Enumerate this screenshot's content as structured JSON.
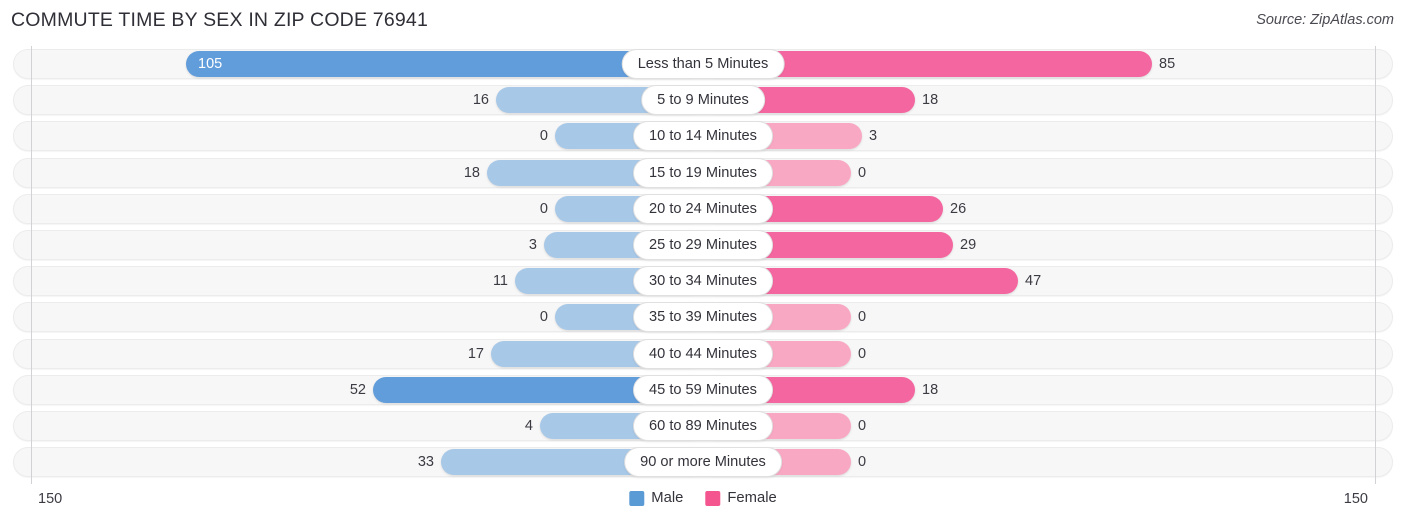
{
  "header": {
    "title": "COMMUTE TIME BY SEX IN ZIP CODE 76941",
    "source": "Source: ZipAtlas.com"
  },
  "axis": {
    "left_max": "150",
    "right_max": "150"
  },
  "legend": {
    "items": [
      {
        "label": "Male",
        "color": "#5b9bd5"
      },
      {
        "label": "Female",
        "color": "#f4558e"
      }
    ]
  },
  "colors": {
    "male_strong": "#629ddb",
    "male_light": "#a8c8e8",
    "female_strong": "#f4669f",
    "female_light": "#f9a8c4",
    "track": "#f7f7f7",
    "axis": "#d2d2d6"
  },
  "chart_data": {
    "type": "bar",
    "subtype": "diverging-horizontal",
    "title": "COMMUTE TIME BY SEX IN ZIP CODE 76941",
    "xlabel": "",
    "ylabel": "",
    "xlim": [
      150,
      150
    ],
    "grid": false,
    "legend_position": "bottom-center",
    "categories": [
      "Less than 5 Minutes",
      "5 to 9 Minutes",
      "10 to 14 Minutes",
      "15 to 19 Minutes",
      "20 to 24 Minutes",
      "25 to 29 Minutes",
      "30 to 34 Minutes",
      "35 to 39 Minutes",
      "40 to 44 Minutes",
      "45 to 59 Minutes",
      "60 to 89 Minutes",
      "90 or more Minutes"
    ],
    "series": [
      {
        "name": "Male",
        "direction": "left",
        "color": "#5b9bd5",
        "values": [
          105,
          16,
          0,
          18,
          0,
          3,
          11,
          0,
          17,
          52,
          4,
          33
        ]
      },
      {
        "name": "Female",
        "direction": "right",
        "color": "#f4558e",
        "values": [
          85,
          18,
          3,
          0,
          26,
          29,
          47,
          0,
          0,
          18,
          0,
          0
        ]
      }
    ]
  },
  "rows": [
    {
      "label": "Less than 5 Minutes",
      "male": "105",
      "female": "85",
      "male_w": 517,
      "female_w": 449,
      "male_strong": true,
      "female_strong": true,
      "male_inside": true
    },
    {
      "label": "5 to 9 Minutes",
      "male": "16",
      "female": "18",
      "male_w": 207,
      "female_w": 212,
      "male_strong": false,
      "female_strong": true,
      "male_inside": false
    },
    {
      "label": "10 to 14 Minutes",
      "male": "0",
      "female": "3",
      "male_w": 148,
      "female_w": 159,
      "male_strong": false,
      "female_strong": false,
      "male_inside": false
    },
    {
      "label": "15 to 19 Minutes",
      "male": "18",
      "female": "0",
      "male_w": 216,
      "female_w": 148,
      "male_strong": false,
      "female_strong": false,
      "male_inside": false
    },
    {
      "label": "20 to 24 Minutes",
      "male": "0",
      "female": "26",
      "male_w": 148,
      "female_w": 240,
      "male_strong": false,
      "female_strong": true,
      "male_inside": false
    },
    {
      "label": "25 to 29 Minutes",
      "male": "3",
      "female": "29",
      "male_w": 159,
      "female_w": 250,
      "male_strong": false,
      "female_strong": true,
      "male_inside": false
    },
    {
      "label": "30 to 34 Minutes",
      "male": "11",
      "female": "47",
      "male_w": 188,
      "female_w": 315,
      "male_strong": false,
      "female_strong": true,
      "male_inside": false
    },
    {
      "label": "35 to 39 Minutes",
      "male": "0",
      "female": "0",
      "male_w": 148,
      "female_w": 148,
      "male_strong": false,
      "female_strong": false,
      "male_inside": false
    },
    {
      "label": "40 to 44 Minutes",
      "male": "17",
      "female": "0",
      "male_w": 212,
      "female_w": 148,
      "male_strong": false,
      "female_strong": false,
      "male_inside": false
    },
    {
      "label": "45 to 59 Minutes",
      "male": "52",
      "female": "18",
      "male_w": 330,
      "female_w": 212,
      "male_strong": true,
      "female_strong": true,
      "male_inside": false
    },
    {
      "label": "60 to 89 Minutes",
      "male": "4",
      "female": "0",
      "male_w": 163,
      "female_w": 148,
      "male_strong": false,
      "female_strong": false,
      "male_inside": false
    },
    {
      "label": "90 or more Minutes",
      "male": "33",
      "female": "0",
      "male_w": 262,
      "female_w": 148,
      "male_strong": false,
      "female_strong": false,
      "male_inside": false
    }
  ]
}
